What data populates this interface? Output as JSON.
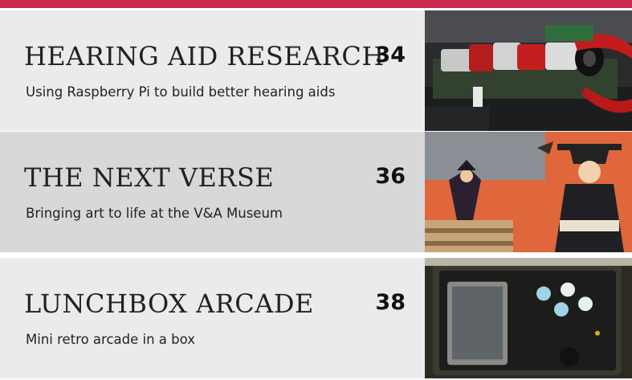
{
  "articles": [
    {
      "title": "HEARING AID RESEARCH",
      "page": "34",
      "description": "Using Raspberry Pi to build better hearing aids"
    },
    {
      "title": "THE NEXT VERSE",
      "page": "36",
      "description": "Bringing art to life at the V&A Museum"
    },
    {
      "title": "LUNCHBOX ARCADE",
      "page": "38",
      "description": "Mini retro arcade in a box"
    }
  ],
  "colors": {
    "accent": "#c9294f",
    "row_light": "#ebebeb",
    "row_dark": "#d8d8d8"
  }
}
